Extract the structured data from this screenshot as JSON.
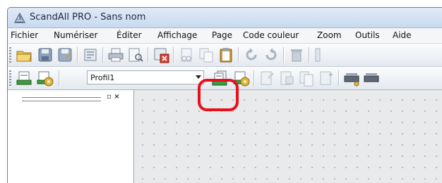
{
  "app": {
    "title": "ScandAll PRO - Sans nom"
  },
  "menu": [
    {
      "label": "Fichier"
    },
    {
      "label": "Numériser"
    },
    {
      "label": "Éditer"
    },
    {
      "label": "Affichage"
    },
    {
      "label": "Page"
    },
    {
      "label": "Code couleur"
    },
    {
      "label": "Zoom"
    },
    {
      "label": "Outils"
    },
    {
      "label": "Aide"
    }
  ],
  "toolbar2": {
    "profile_value": "Profil1"
  },
  "left_panel": {
    "buttons": "▫ ×"
  },
  "colors": {
    "highlight": "#e8101b",
    "accent": "#2f8f2f"
  }
}
